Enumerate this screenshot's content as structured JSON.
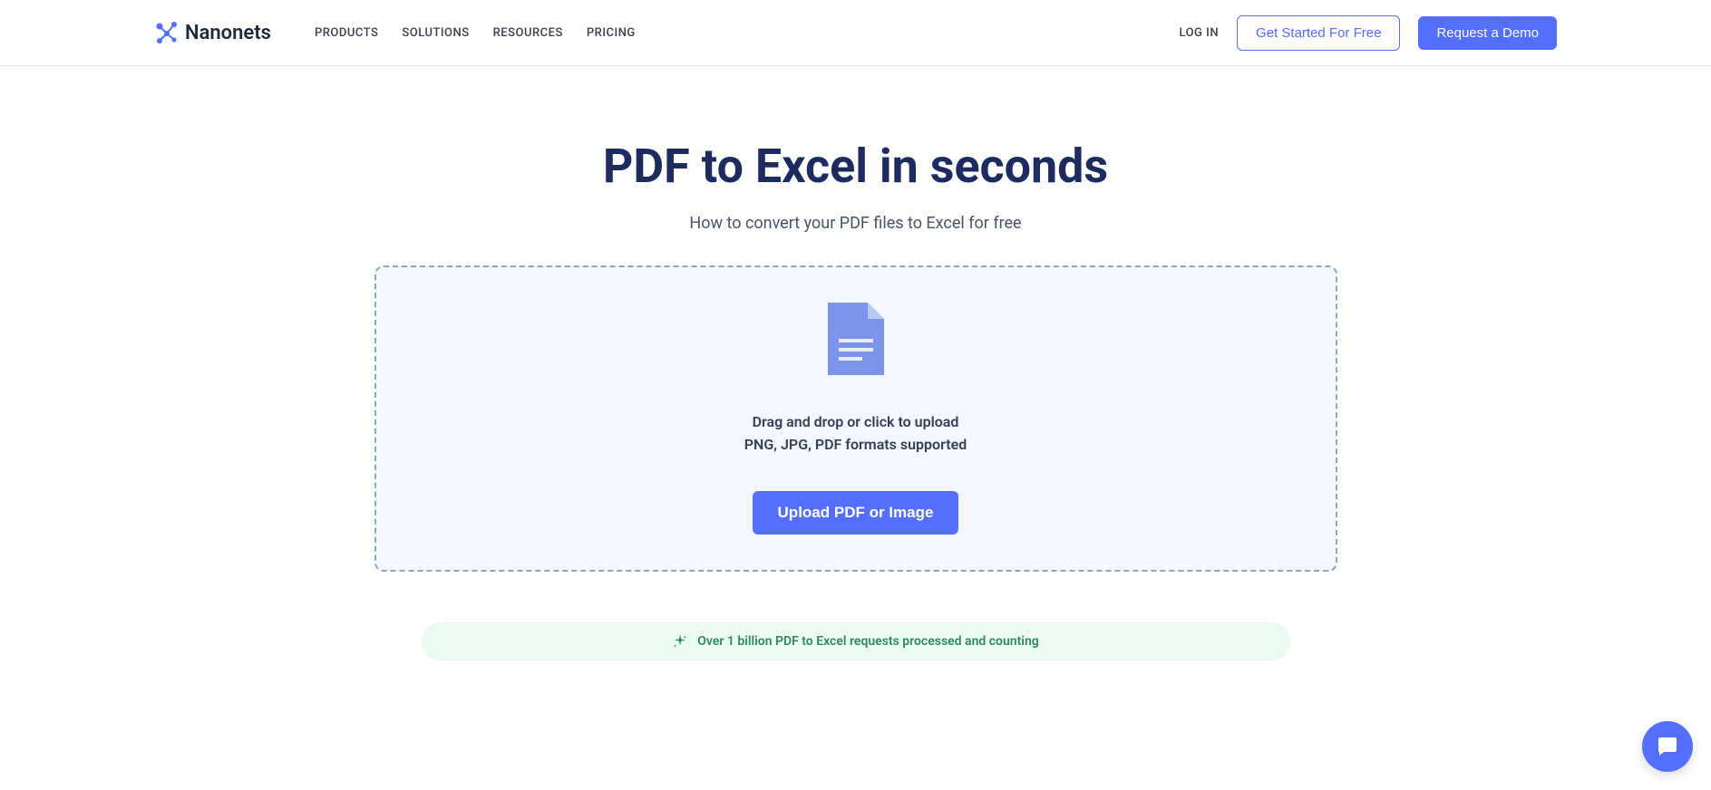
{
  "header": {
    "logo_text": "Nanonets",
    "nav": {
      "products": "PRODUCTS",
      "solutions": "SOLUTIONS",
      "resources": "RESOURCES",
      "pricing": "PRICING"
    },
    "login": "LOG IN",
    "get_started": "Get Started For Free",
    "request_demo": "Request a Demo"
  },
  "main": {
    "title": "PDF to Excel in seconds",
    "subtitle": "How to convert your PDF files to Excel for free",
    "dropzone": {
      "drop_text": "Drag and drop or click to upload",
      "format_text": "PNG, JPG, PDF formats supported",
      "upload_button": "Upload PDF or Image"
    },
    "banner_text": "Over 1 billion PDF to Excel requests processed and counting"
  }
}
